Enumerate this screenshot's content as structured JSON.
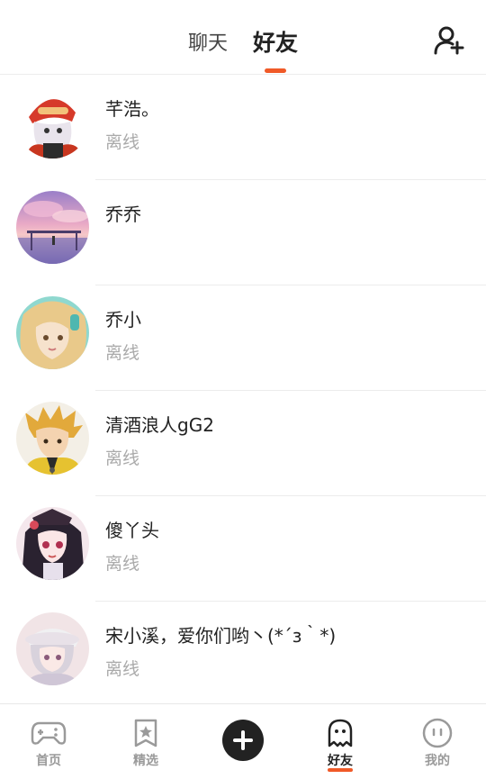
{
  "header": {
    "tabs": [
      {
        "label": "聊天",
        "active": false
      },
      {
        "label": "好友",
        "active": true
      }
    ],
    "add_friend_icon": "add-user-icon",
    "accent_color": "#f05a28"
  },
  "friends": [
    {
      "name": "芊浩。",
      "status": "离线",
      "avatar": "avatar-anime-red-helmet"
    },
    {
      "name": "乔乔",
      "status": "",
      "avatar": "avatar-pink-sunset-scene"
    },
    {
      "name": "乔小",
      "status": "离线",
      "avatar": "avatar-anime-blonde-girl"
    },
    {
      "name": "清酒浪人gG2",
      "status": "离线",
      "avatar": "avatar-anime-spiky-hair"
    },
    {
      "name": "傻丫头",
      "status": "离线",
      "avatar": "avatar-anime-dark-hair-girl"
    },
    {
      "name": "宋小溪，爱你们哟丶(*´з｀*)",
      "status": "离线",
      "avatar": "avatar-anime-white-hat"
    }
  ],
  "bottom_nav": [
    {
      "label": "首页",
      "icon": "gamepad-icon",
      "active": false
    },
    {
      "label": "精选",
      "icon": "star-bookmark-icon",
      "active": false
    },
    {
      "label": "",
      "icon": "plus-icon",
      "active": false
    },
    {
      "label": "好友",
      "icon": "ghost-icon",
      "active": true
    },
    {
      "label": "我的",
      "icon": "face-icon",
      "active": false
    }
  ]
}
